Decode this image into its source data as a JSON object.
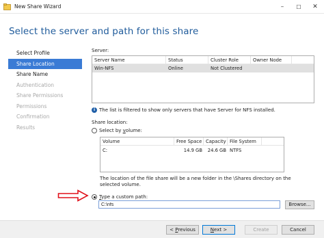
{
  "window": {
    "title": "New Share Wizard",
    "minimize_glyph": "–",
    "maximize_glyph": "☐",
    "close_glyph": "✕"
  },
  "page_title": "Select the server and path for this share",
  "nav": {
    "items": [
      {
        "label": "Select Profile",
        "state": "normal"
      },
      {
        "label": "Share Location",
        "state": "selected"
      },
      {
        "label": "Share Name",
        "state": "normal"
      },
      {
        "label": "Authentication",
        "state": "disabled"
      },
      {
        "label": "Share Permissions",
        "state": "disabled"
      },
      {
        "label": "Permissions",
        "state": "disabled"
      },
      {
        "label": "Confirmation",
        "state": "disabled"
      },
      {
        "label": "Results",
        "state": "disabled"
      }
    ]
  },
  "server": {
    "label": "Server:",
    "columns": [
      "Server Name",
      "Status",
      "Cluster Role",
      "Owner Node"
    ],
    "rows": [
      {
        "name": "Win-NFS",
        "status": "Online",
        "cluster_role": "Not Clustered",
        "owner_node": ""
      }
    ],
    "info_text": "The list is filtered to show only servers that have Server for NFS installed."
  },
  "share_location": {
    "label": "Share location:",
    "select_by_volume": {
      "prefix": "Select by ",
      "accel": "v",
      "suffix": "olume:"
    },
    "volume_columns": [
      "Volume",
      "Free Space",
      "Capacity",
      "File System"
    ],
    "volume_rows": [
      {
        "volume": "C:",
        "free_space": "14.9 GB",
        "capacity": "24.6 GB",
        "file_system": "NTFS"
      }
    ],
    "note": "The location of the file share will be a new folder in the \\Shares directory on the selected volume.",
    "custom_path": {
      "accel": "T",
      "rest": "ype a custom path:",
      "value": "C:\\nfs",
      "checked": true
    },
    "browse_label": "Browse..."
  },
  "footer": {
    "previous": {
      "prefix": "< ",
      "accel": "P",
      "rest": "revious"
    },
    "next": {
      "accel": "N",
      "rest": "ext >"
    },
    "create": "Create",
    "cancel": "Cancel"
  },
  "colors": {
    "title_blue": "#1f5b9b",
    "nav_selected": "#3a7bd5",
    "annotation_arrow": "#e0101a"
  },
  "icons": [
    "wizard-app-icon",
    "info-icon",
    "red-arrow-annotation-icon"
  ]
}
